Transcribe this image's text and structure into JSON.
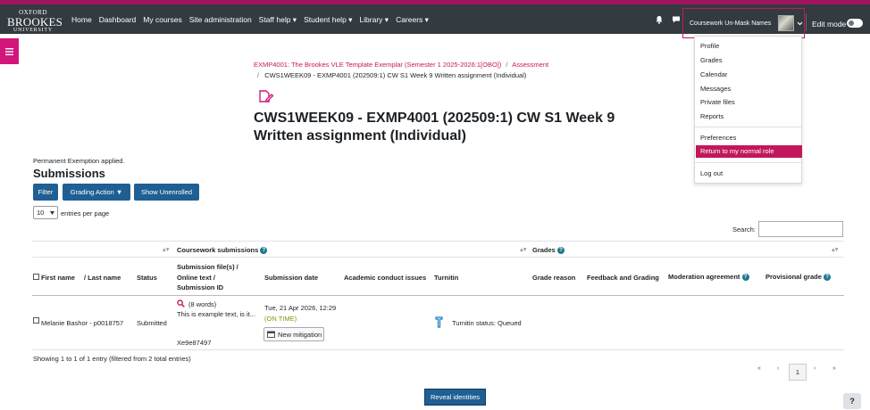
{
  "logo": {
    "line1": "OXFORD",
    "line2": "BROOKES",
    "line3": "UNIVERSITY"
  },
  "nav": {
    "items": [
      "Home",
      "Dashboard",
      "My courses",
      "Site administration",
      "Staff help ▾",
      "Student help ▾",
      "Library ▾",
      "Careers ▾"
    ]
  },
  "usermenu": {
    "name": "Coursework Un-Mask Names",
    "edit_mode": "Edit mode"
  },
  "dropdown": {
    "items": [
      "Profile",
      "Grades",
      "Calendar",
      "Messages",
      "Private files",
      "Reports",
      "Preferences",
      "Return to my normal role",
      "Log out"
    ]
  },
  "breadcrumb": {
    "course": "EXMP4001: The Brookes VLE Template Exemplar (Semester 1 2025-2026:1[OBO])",
    "sep1": "/",
    "assessment": "Assessment",
    "sep2": "/",
    "current": "CWS1WEEK09 - EXMP4001 (202509:1) CW S1 Week 9 Written assignment (Individual)"
  },
  "page": {
    "title": "CWS1WEEK09 - EXMP4001 (202509:1) CW S1 Week 9 Written assignment (Individual)",
    "exemption": "Permanent Exemption applied.",
    "subheading": "Submissions"
  },
  "buttons": {
    "filter": "Filter",
    "grading_action": "Grading Action ▼",
    "show_unenrolled": "Show Unenrolled",
    "reveal": "Reveal identities"
  },
  "entries": {
    "value": "10",
    "label": "entries per page"
  },
  "search": {
    "label": "Search:"
  },
  "table": {
    "group_headers": {
      "coursework": "Coursework submissions",
      "grades": "Grades"
    },
    "columns": {
      "first_name": "First name",
      "last_name": "/ Last name",
      "status": "Status",
      "submission_line1": "Submission file(s) /",
      "submission_line2": "Online text /",
      "submission_line3": "Submission ID",
      "submission_date": "Submission date",
      "academic_conduct": "Academic conduct issues",
      "turnitin": "Turnitin",
      "grade_reason": "Grade reason",
      "feedback": "Feedback and Grading",
      "moderation": "Moderation agreement",
      "provisional": "Provisional grade"
    },
    "row": {
      "name": "Melanie Bashor - p0018757",
      "status": "Submitted",
      "words": "(8 words)",
      "text_excerpt": "This is example text, is it...",
      "submission_id": "Xe9e87497",
      "date": "Tue, 21 Apr 2026, 12:29",
      "on_time": "(ON TIME)",
      "mitigation": "New mitigation",
      "turnitin_status": "Turnitin status: Queued"
    }
  },
  "footer": {
    "showing": "Showing 1 to 1 of 1 entry (filtered from 2 total entries)",
    "page": "1"
  },
  "pagination": {
    "first": "«",
    "prev": "‹",
    "next": "›",
    "last": "»"
  },
  "help": "?"
}
